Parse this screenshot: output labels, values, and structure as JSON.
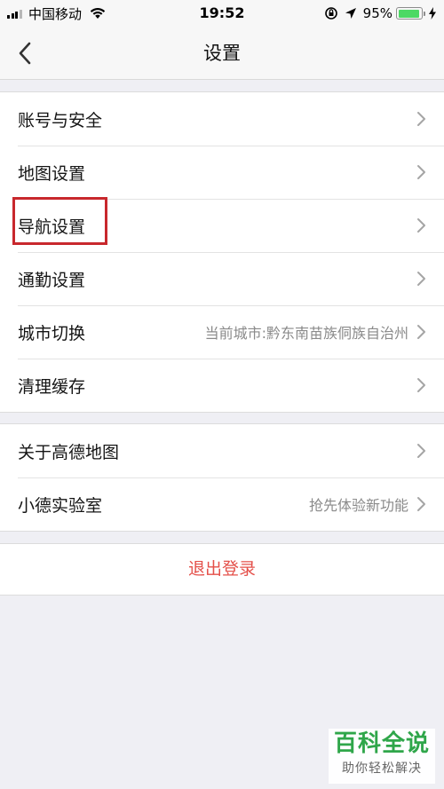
{
  "status_bar": {
    "carrier": "中国移动",
    "time": "19:52",
    "battery": "95%",
    "battery_level": 0.95,
    "icons": [
      "signal-icon",
      "wifi-icon",
      "orientation-lock-icon",
      "location-arrow-icon",
      "battery-icon",
      "charging-icon"
    ]
  },
  "nav": {
    "title": "设置",
    "back_icon": "chevron-left-icon"
  },
  "groups": [
    {
      "items": [
        {
          "label": "账号与安全",
          "value": ""
        },
        {
          "label": "地图设置",
          "value": ""
        },
        {
          "label": "导航设置",
          "value": "",
          "highlighted": true
        },
        {
          "label": "通勤设置",
          "value": ""
        },
        {
          "label": "城市切换",
          "value": "当前城市:黔东南苗族侗族自治州"
        },
        {
          "label": "清理缓存",
          "value": ""
        }
      ]
    },
    {
      "items": [
        {
          "label": "关于高德地图",
          "value": ""
        },
        {
          "label": "小德实验室",
          "value": "抢先体验新功能"
        }
      ]
    }
  ],
  "logout": {
    "label": "退出登录",
    "color": "#e4504a"
  },
  "watermark": {
    "title": "百科全说",
    "subtitle": "助你轻松解决",
    "color": "#2fa64a"
  },
  "colors": {
    "background": "#efeff4",
    "highlight_box": "#c8282d",
    "battery_fill": "#4cd964"
  }
}
